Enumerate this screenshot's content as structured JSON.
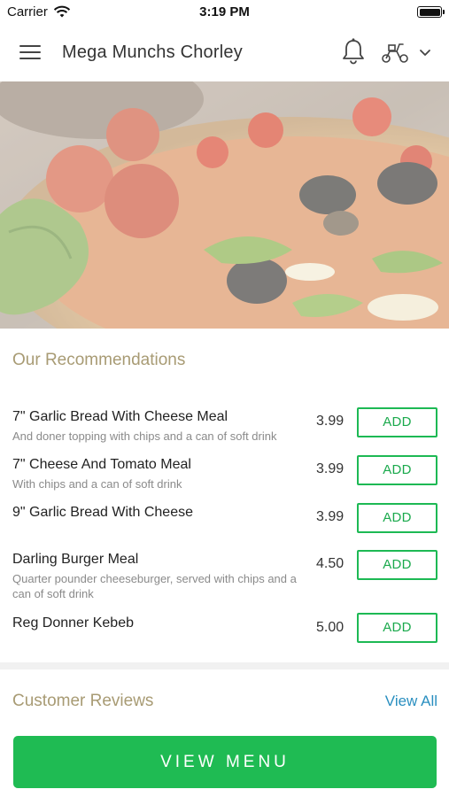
{
  "status_bar": {
    "carrier": "Carrier",
    "time": "3:19 PM"
  },
  "header": {
    "title": "Mega Munchs Chorley",
    "icons": [
      "menu-icon",
      "bell-icon",
      "scooter-icon",
      "chevron-down-icon"
    ]
  },
  "recommendations": {
    "title": "Our Recommendations",
    "add_label": "ADD",
    "items": [
      {
        "name": "7\" Garlic Bread With Cheese Meal",
        "description": "And doner topping with chips and a can of soft drink",
        "price": "3.99"
      },
      {
        "name": "7\" Cheese And Tomato Meal",
        "description": "With chips and a can of soft drink",
        "price": "3.99"
      },
      {
        "name": "9\" Garlic Bread With Cheese",
        "description": "",
        "price": "3.99"
      },
      {
        "name": "Darling Burger Meal",
        "description": "Quarter pounder cheeseburger, served with chips and a can of soft drink",
        "price": "4.50"
      },
      {
        "name": "Reg Donner Kebeb",
        "description": "",
        "price": "5.00"
      }
    ]
  },
  "reviews": {
    "title": "Customer Reviews",
    "view_all": "View All"
  },
  "cta": {
    "label": "VIEW MENU"
  },
  "colors": {
    "accent_green": "#1fbb53",
    "section_title": "#a89b74",
    "link_blue": "#2a8fc0"
  }
}
